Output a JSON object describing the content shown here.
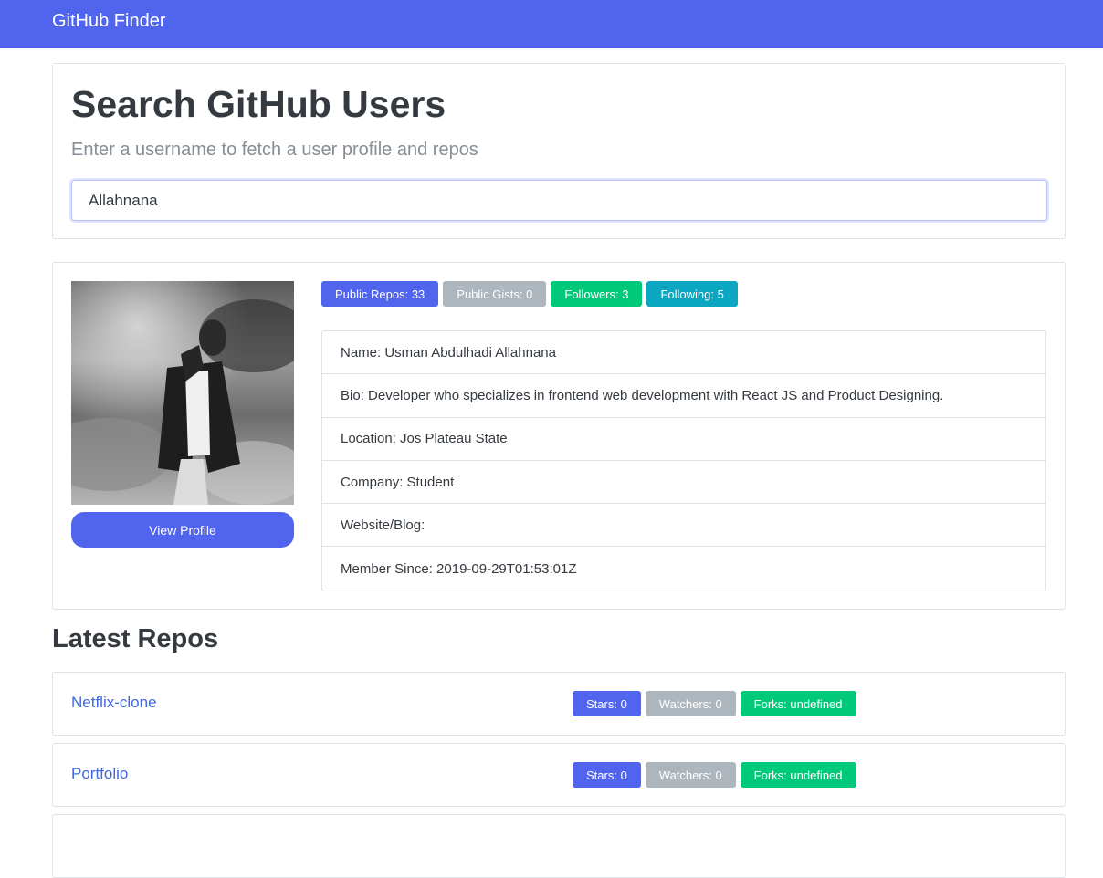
{
  "navbar": {
    "brand": "GitHub Finder"
  },
  "search": {
    "title": "Search GitHub Users",
    "lead": "Enter a username to fetch a user profile and repos",
    "value": "Allahnana"
  },
  "profile": {
    "view_profile_label": "View Profile",
    "badges": {
      "public_repos": "Public Repos: 33",
      "public_gists": "Public Gists: 0",
      "followers": "Followers: 3",
      "following": "Following: 5"
    },
    "info": {
      "name": "Name: Usman Abdulhadi Allahnana",
      "bio": "Bio: Developer who specializes in frontend web development with React JS and Product Designing.",
      "location": "Location: Jos Plateau State",
      "company": "Company: Student",
      "website": "Website/Blog:",
      "member_since": "Member Since: 2019-09-29T01:53:01Z"
    }
  },
  "repos": {
    "heading": "Latest Repos",
    "items": [
      {
        "name": "Netflix-clone",
        "stars": "Stars: 0",
        "watchers": "Watchers: 0",
        "forks": "Forks: undefined"
      },
      {
        "name": "Portfolio",
        "stars": "Stars: 0",
        "watchers": "Watchers: 0",
        "forks": "Forks: undefined"
      }
    ]
  },
  "colors": {
    "primary": "#5064ee",
    "secondary": "#adb5bd",
    "success": "#00c97b",
    "info": "#0aa6c2",
    "link": "#4066e0"
  }
}
